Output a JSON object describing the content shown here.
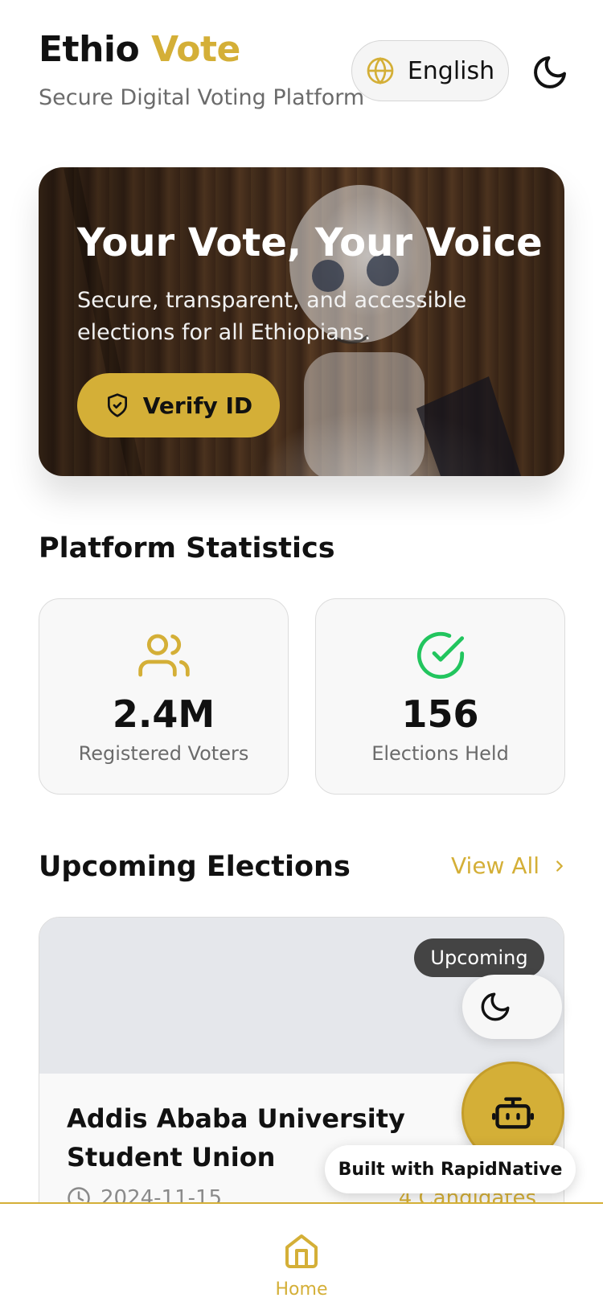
{
  "header": {
    "brand_primary": "Ethio",
    "brand_accent": "Vote",
    "subtitle": "Secure Digital Voting Platform",
    "language_label": "English"
  },
  "hero": {
    "title": "Your Vote, Your Voice",
    "text": "Secure, transparent, and accessible elections for all Ethiopians.",
    "verify_label": "Verify ID"
  },
  "stats": {
    "section_title": "Platform Statistics",
    "items": [
      {
        "value": "2.4M",
        "label": "Registered Voters",
        "icon": "users-icon"
      },
      {
        "value": "156",
        "label": "Elections Held",
        "icon": "check-circle-icon"
      }
    ]
  },
  "elections": {
    "section_title": "Upcoming Elections",
    "view_all_label": "View All",
    "items": [
      {
        "status": "Upcoming",
        "title": "Addis Ababa University Student Union",
        "date": "2024-11-15",
        "candidates": "4 Candidates"
      }
    ]
  },
  "floating": {
    "built_with": "Built with RapidNative"
  },
  "tabbar": {
    "home_label": "Home"
  },
  "colors": {
    "accent": "#d4af37",
    "badge_bg": "#444444",
    "success": "#22c55e"
  }
}
